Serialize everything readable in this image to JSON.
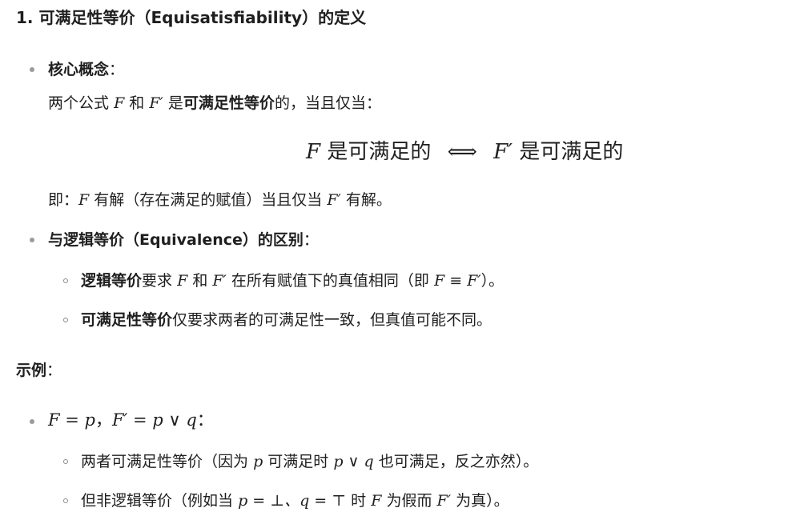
{
  "heading": "1. 可满足性等价（Equisatisfiability）的定义",
  "core": {
    "label": "核心概念",
    "colon": "：",
    "l1_pre": "两个公式",
    "F": "F",
    "and": "和",
    "Fp": "F′",
    "is": "是",
    "term": "可满足性等价",
    "l1_post": "的，当且仅当：",
    "eq_F": "F",
    "eq_sat1": "是可满足的",
    "eq_iff": "⟺",
    "eq_Fp": "F′",
    "eq_sat2": "是可满足的",
    "l3_pre": "即：",
    "l3_mid": "有解（存在满足的赋值）当且仅当",
    "l3_post": "有解。"
  },
  "diff": {
    "label": "与逻辑等价（Equivalence）的区别",
    "colon": "：",
    "s1_term": "逻辑等价",
    "s1_pre": "要求",
    "s1_and": "和",
    "s1_mid": "在所有赋值下的真值相同（即",
    "s1_equiv": "F ≡ F′",
    "s1_post": "）。",
    "s2_term": "可满足性等价",
    "s2_text": "仅要求两者的可满足性一致，但真值可能不同。"
  },
  "example": {
    "label": "示例",
    "colon": "：",
    "bullet_math1": "F = p",
    "bullet_sep": "，",
    "bullet_math2": "F′ = p ∨ q",
    "bullet_colon": "：",
    "s1_pre": "两者可满足性等价（因为",
    "s1_p": "p",
    "s1_mid": "可满足时",
    "s1_pq": "p ∨ q",
    "s1_post": "也可满足，反之亦然）。",
    "s2_pre": "但非逻辑等价（例如当",
    "s2_math": "p = ⊥、q = ⊤",
    "s2_mid": "时",
    "s2_F": "F",
    "s2_mid2": "为假而",
    "s2_Fp": "F′",
    "s2_post": "为真）。"
  }
}
